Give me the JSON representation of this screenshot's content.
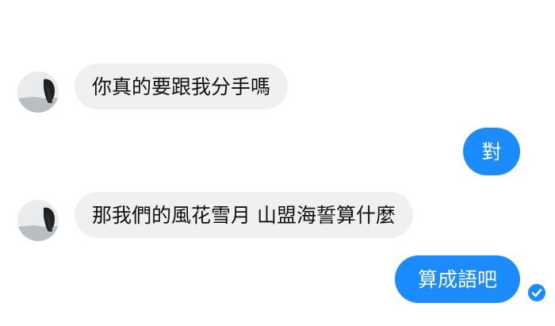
{
  "colors": {
    "incoming_bubble": "#f0f0f0",
    "outgoing_bubble": "#1a8cff",
    "incoming_text": "#111111",
    "outgoing_text": "#ffffff"
  },
  "messages": [
    {
      "sender": "other",
      "text": "你真的要跟我分手嗎",
      "avatar": "contact-avatar"
    },
    {
      "sender": "me",
      "text": "對"
    },
    {
      "sender": "other",
      "text": "那我們的風花雪月 山盟海誓算什麼",
      "avatar": "contact-avatar"
    },
    {
      "sender": "me",
      "text": "算成語吧",
      "status_icon": "seen-check-icon"
    }
  ]
}
